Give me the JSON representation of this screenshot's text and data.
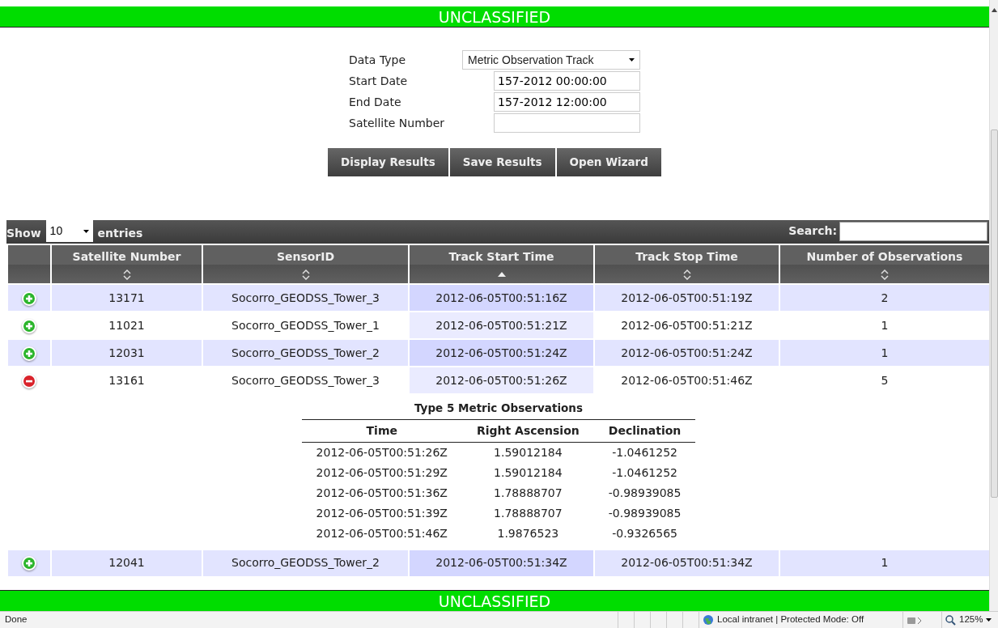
{
  "banner_top": {
    "text": "UNCLASSIFIED"
  },
  "form": {
    "fields": [
      {
        "kind": "select",
        "label": "Data Type",
        "value": "Metric Observation Track"
      },
      {
        "kind": "text",
        "label": "Start Date",
        "value": "157-2012 00:00:00"
      },
      {
        "kind": "text",
        "label": "End Date",
        "value": "157-2012 12:00:00"
      },
      {
        "kind": "text",
        "label": "Satellite Number"
      }
    ],
    "buttons": [
      "Display Results",
      "Save Results",
      "Open Wizard"
    ]
  },
  "table": {
    "show_label": "Show",
    "page_length": "10",
    "entries_label": "entries",
    "search_label": "Search:",
    "columns": [
      {
        "label": "Satellite Number",
        "sorted": false
      },
      {
        "label": "SensorID",
        "sorted": false
      },
      {
        "label": "Track Start Time",
        "sorted": true
      },
      {
        "label": "Track Stop Time",
        "sorted": false
      },
      {
        "label": "Number of Observations",
        "sorted": false
      }
    ],
    "rows": [
      {
        "expanded": false,
        "cells": [
          "13171",
          "Socorro_GEODSS_Tower_3",
          "2012-06-05T00:51:16Z",
          "2012-06-05T00:51:19Z",
          "2"
        ]
      },
      {
        "expanded": false,
        "cells": [
          "11021",
          "Socorro_GEODSS_Tower_1",
          "2012-06-05T00:51:21Z",
          "2012-06-05T00:51:21Z",
          "1"
        ]
      },
      {
        "expanded": false,
        "cells": [
          "12031",
          "Socorro_GEODSS_Tower_2",
          "2012-06-05T00:51:24Z",
          "2012-06-05T00:51:24Z",
          "1"
        ]
      },
      {
        "expanded": true,
        "cells": [
          "13161",
          "Socorro_GEODSS_Tower_3",
          "2012-06-05T00:51:26Z",
          "2012-06-05T00:51:46Z",
          "5"
        ],
        "details": {
          "title": "Type 5 Metric Observations",
          "columns": [
            "Time",
            "Right Ascension",
            "Declination"
          ],
          "rows": [
            [
              "2012-06-05T00:51:26Z",
              "1.59012184",
              "-1.0461252"
            ],
            [
              "2012-06-05T00:51:29Z",
              "1.59012184",
              "-1.0461252"
            ],
            [
              "2012-06-05T00:51:36Z",
              "1.78888707",
              "-0.98939085"
            ],
            [
              "2012-06-05T00:51:39Z",
              "1.78888707",
              "-0.98939085"
            ],
            [
              "2012-06-05T00:51:46Z",
              "1.9876523",
              "-0.9326565"
            ]
          ]
        }
      },
      {
        "expanded": false,
        "cells": [
          "12041",
          "Socorro_GEODSS_Tower_2",
          "2012-06-05T00:51:34Z",
          "2012-06-05T00:51:34Z",
          "1"
        ]
      }
    ]
  },
  "banner_bottom": {
    "text": "UNCLASSIFIED"
  },
  "status_bar": {
    "status": "Done",
    "zone": "Local intranet | Protected Mode: Off",
    "zoom": "125%"
  }
}
